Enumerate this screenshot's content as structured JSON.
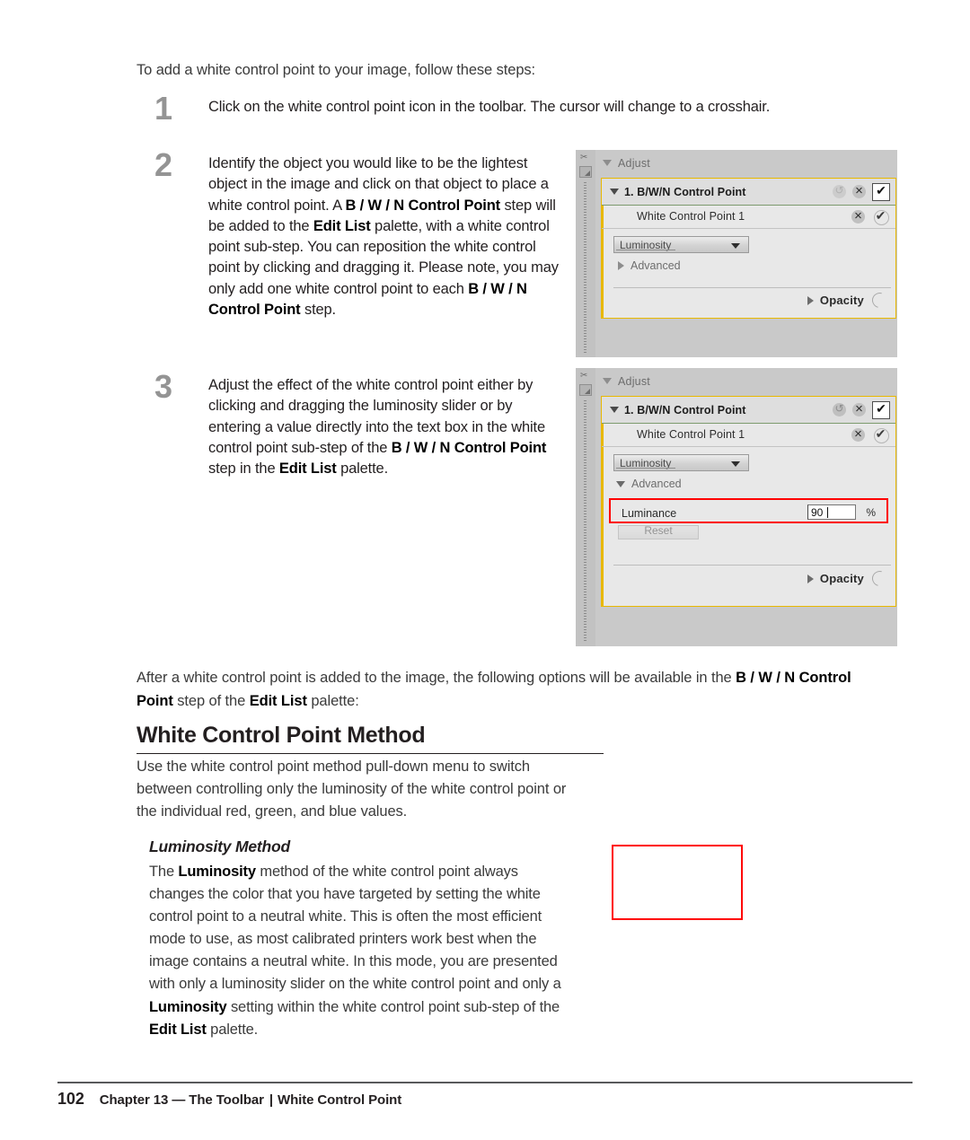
{
  "document": {
    "intro": "To add a white control point to your image, follow these steps:",
    "steps": [
      {
        "number": "1",
        "html": "Click on the white control point icon in the toolbar. The cursor will change to a crosshair."
      },
      {
        "number": "2",
        "html": "Identify the object you would like to be the lightest object in the image and click on that object to place a white control point. A <b>B / W / N Control Point</b> step will be added to the <b>Edit List</b> palette, with a white control point sub-step. You can reposition the white control point by clicking and dragging it. Please note, you may only add one white control point to each <b>B / W / N Control Point</b> step."
      },
      {
        "number": "3",
        "html": "Adjust the effect of the white control point either by clicking and dragging the luminosity slider or by entering a value directly into the text box in the white control point sub-step of the <b>B / W / N Control Point</b> step in the <b>Edit List</b> palette."
      }
    ],
    "after_paragraph": "After a white control point is added to the image, the following options will be available in the <b>B / W / N Control Point</b> step of the <b>Edit List</b> palette:",
    "section_heading": "White Control Point Method",
    "section_paragraph": "Use the white control point method pull-down menu to switch between controlling only the luminosity of the white control point or the individual red, green, and blue values.",
    "sub_heading": "Luminosity Method",
    "sub_paragraph": "The <b>Luminosity</b> method of the white control point always changes the color that you have targeted by setting the white control point to a neutral white. This is often the most efficient mode to use, as most calibrated printers work best when the image contains a neutral white. In this mode, you are presented with only a luminosity slider on the white control point and only a <b>Luminosity</b> setting within the white control point sub-step of the <b>Edit List</b> palette."
  },
  "footer": {
    "page_number": "102",
    "chapter": "Chapter 13 — The Toolbar",
    "separator": "|",
    "topic": "White Control Point"
  },
  "colors": {
    "highlight_red": "#ff0000",
    "card_outline_yellow": "#e8b800",
    "panel_background": "#c9c9c9",
    "card_background": "#e8e8e8"
  },
  "figures": {
    "panel_1": {
      "adjust_label": "Adjust",
      "step_title": "1. B/W/N Control Point",
      "substep_label": "White Control Point 1",
      "method_dropdown": "Luminosity",
      "advanced_label": "Advanced",
      "opacity_label": "Opacity",
      "icons": {
        "collapse": "triangle-down-icon",
        "reset": "reset-icon",
        "delete": "close-icon",
        "enabled": "checkmark-icon",
        "dropdown_caret": "chevron-down-icon",
        "advanced_disclosure": "triangle-right-icon",
        "opacity_disclosure": "triangle-right-icon",
        "opacity_knob": "dial-knob-icon"
      }
    },
    "panel_2": {
      "adjust_label": "Adjust",
      "step_title": "1. B/W/N Control Point",
      "substep_label": "White Control Point 1",
      "method_dropdown": "Luminosity",
      "advanced_label": "Advanced",
      "luminance_label": "Luminance",
      "luminance_value": "90",
      "luminance_unit": "%",
      "reset_label": "Reset",
      "opacity_label": "Opacity",
      "icons": {
        "collapse": "triangle-down-icon",
        "reset": "reset-icon",
        "delete": "close-icon",
        "enabled": "checkmark-icon",
        "dropdown_caret": "chevron-down-icon",
        "advanced_disclosure": "triangle-down-icon",
        "opacity_disclosure": "triangle-right-icon",
        "opacity_knob": "dial-knob-icon"
      }
    },
    "placeholder_box": {
      "note": ""
    }
  }
}
